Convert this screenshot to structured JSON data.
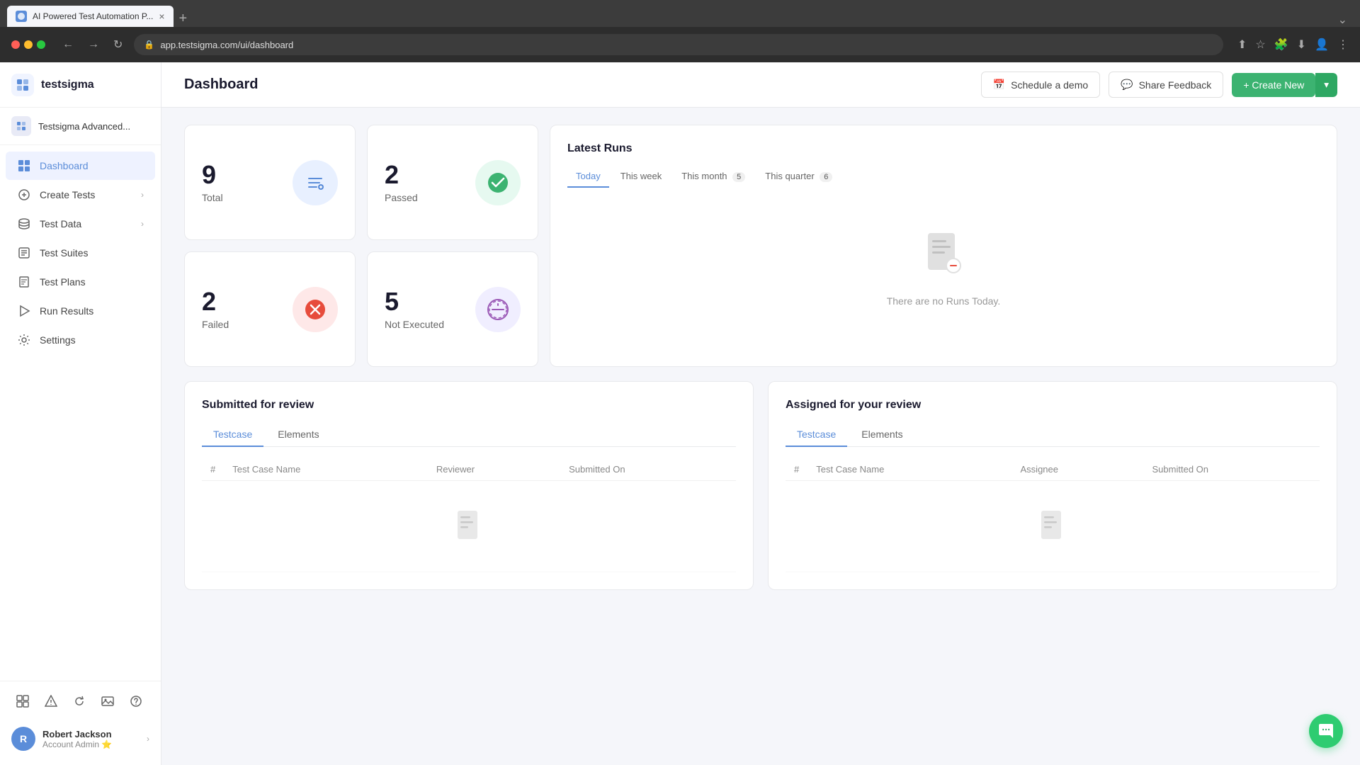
{
  "browser": {
    "tab_title": "AI Powered Test Automation P...",
    "url": "app.testsigma.com/ui/dashboard",
    "tab_close": "×",
    "tab_add": "+"
  },
  "app": {
    "logo_text": "testsigma"
  },
  "sidebar": {
    "project_name": "Testsigma Advanced...",
    "nav_items": [
      {
        "id": "dashboard",
        "label": "Dashboard",
        "active": true,
        "has_arrow": false
      },
      {
        "id": "create-tests",
        "label": "Create Tests",
        "active": false,
        "has_arrow": true
      },
      {
        "id": "test-data",
        "label": "Test Data",
        "active": false,
        "has_arrow": true
      },
      {
        "id": "test-suites",
        "label": "Test Suites",
        "active": false,
        "has_arrow": false
      },
      {
        "id": "test-plans",
        "label": "Test Plans",
        "active": false,
        "has_arrow": false
      },
      {
        "id": "run-results",
        "label": "Run Results",
        "active": false,
        "has_arrow": false
      },
      {
        "id": "settings",
        "label": "Settings",
        "active": false,
        "has_arrow": false
      }
    ],
    "user": {
      "name": "Robert Jackson",
      "role": "Account Admin",
      "emoji": "⭐",
      "avatar_initials": "R"
    }
  },
  "header": {
    "page_title": "Dashboard",
    "schedule_demo_label": "Schedule a demo",
    "share_feedback_label": "Share Feedback",
    "create_new_label": "+ Create New"
  },
  "stats": {
    "total": {
      "number": "9",
      "label": "Total"
    },
    "passed": {
      "number": "2",
      "label": "Passed"
    },
    "failed": {
      "number": "2",
      "label": "Failed"
    },
    "not_executed": {
      "number": "5",
      "label": "Not Executed"
    }
  },
  "latest_runs": {
    "title": "Latest Runs",
    "tabs": [
      {
        "id": "today",
        "label": "Today",
        "active": true,
        "count": null
      },
      {
        "id": "this-week",
        "label": "This week",
        "active": false,
        "count": null
      },
      {
        "id": "this-month",
        "label": "This month",
        "active": false,
        "count": "5"
      },
      {
        "id": "this-quarter",
        "label": "This quarter",
        "active": false,
        "count": "6"
      }
    ],
    "empty_text": "There are no Runs Today."
  },
  "submitted_review": {
    "title": "Submitted for review",
    "tabs": [
      {
        "id": "testcase",
        "label": "Testcase",
        "active": true
      },
      {
        "id": "elements",
        "label": "Elements",
        "active": false
      }
    ],
    "table_headers": [
      "#",
      "Test Case Name",
      "Reviewer",
      "Submitted On"
    ]
  },
  "assigned_review": {
    "title": "Assigned for your review",
    "tabs": [
      {
        "id": "testcase",
        "label": "Testcase",
        "active": true
      },
      {
        "id": "elements",
        "label": "Elements",
        "active": false
      }
    ],
    "table_headers": [
      "#",
      "Test Case Name",
      "Assignee",
      "Submitted On"
    ]
  }
}
